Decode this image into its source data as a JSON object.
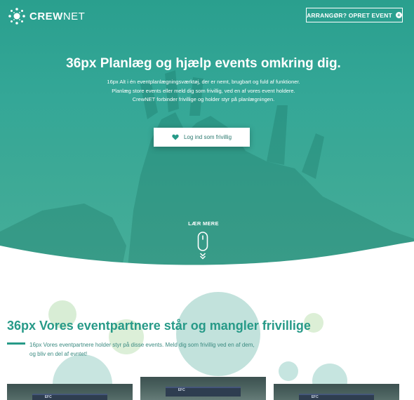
{
  "header": {
    "logo_text_bold": "CREW",
    "logo_text_light": "NET",
    "cta_label": "ARRANGØR? OPRET EVENT"
  },
  "hero": {
    "title": "36px Planlæg og hjælp events omkring dig.",
    "description_lines": [
      "16px Alt i én eventplanlægningsværktøj, der er nemt, brugbart og fuld af funktioner.",
      "Planlæg store events eller meld dig som frivillig, ved en af vores event holdere.",
      "CrewNET forbinder frivillige og holder styr på planlægningen."
    ],
    "login_button_label": "Log ind som frivillig",
    "learn_more_label": "LÆR MERE"
  },
  "partners": {
    "title": "36px Vores eventpartnere står og mangler frivillige",
    "description_lines": [
      "16px Vores eventpartnere holder styr på disse events. Meld dig som frivillig ved en af dem,",
      "og bliv en del af evntet!"
    ],
    "cards": [
      {
        "label": "EFC"
      },
      {
        "label": "EFC"
      },
      {
        "label": "EFC"
      }
    ]
  },
  "colors": {
    "brand_teal": "#279a88",
    "hero_gradient_top": "#2a9f8e",
    "hero_gradient_bottom": "#47ae99",
    "bubble_light_green": "#d6ecd4",
    "bubble_teal": "#bfe1dc"
  },
  "icons": {
    "logo": "crewnet-dots-logo",
    "cta": "plus-circle-icon",
    "login": "heart-icon",
    "scroll": "mouse-scroll-icon"
  }
}
